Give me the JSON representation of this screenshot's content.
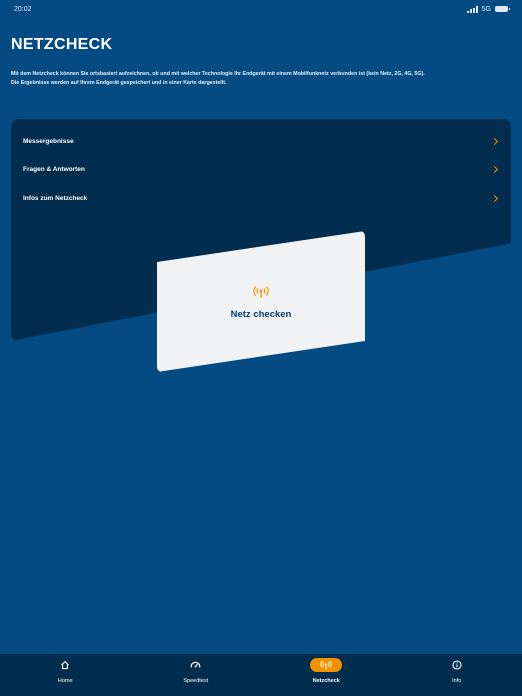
{
  "status_bar": {
    "time": "20:02",
    "network": "5G"
  },
  "header": {
    "title": "NETZCHECK"
  },
  "intro": {
    "line1": "Mit dem Netzcheck können Sie ortsbasiert aufzeichnen, ob und mit welcher Technologie Ihr Endgerät mit einem Mobilfunknetz verbunden ist (kein Netz, 2G, 4G, 5G).",
    "line2": "Die Ergebnisse werden auf Ihrem Endgerät gespeichert und in einer Karte dargestellt."
  },
  "menu": {
    "items": [
      {
        "label": "Messergebnisse",
        "icon": "chevron-right-icon"
      },
      {
        "label": "Fragen & Antworten",
        "icon": "chevron-right-icon"
      },
      {
        "label": "Infos zum Netzcheck",
        "icon": "chevron-right-icon"
      }
    ]
  },
  "check_card": {
    "label": "Netz checken",
    "icon": "antenna-signal-icon"
  },
  "tab_bar": {
    "tabs": [
      {
        "label": "Home",
        "icon": "home-icon",
        "active": false
      },
      {
        "label": "Speedtest",
        "icon": "speedometer-icon",
        "active": false
      },
      {
        "label": "Netzcheck",
        "icon": "antenna-signal-icon",
        "active": true
      },
      {
        "label": "Info",
        "icon": "info-icon",
        "active": false
      }
    ]
  },
  "colors": {
    "background": "#034b82",
    "panel": "#022d4f",
    "accent": "#f39200",
    "card": "#f1f2f3",
    "card_text": "#073f6d"
  }
}
